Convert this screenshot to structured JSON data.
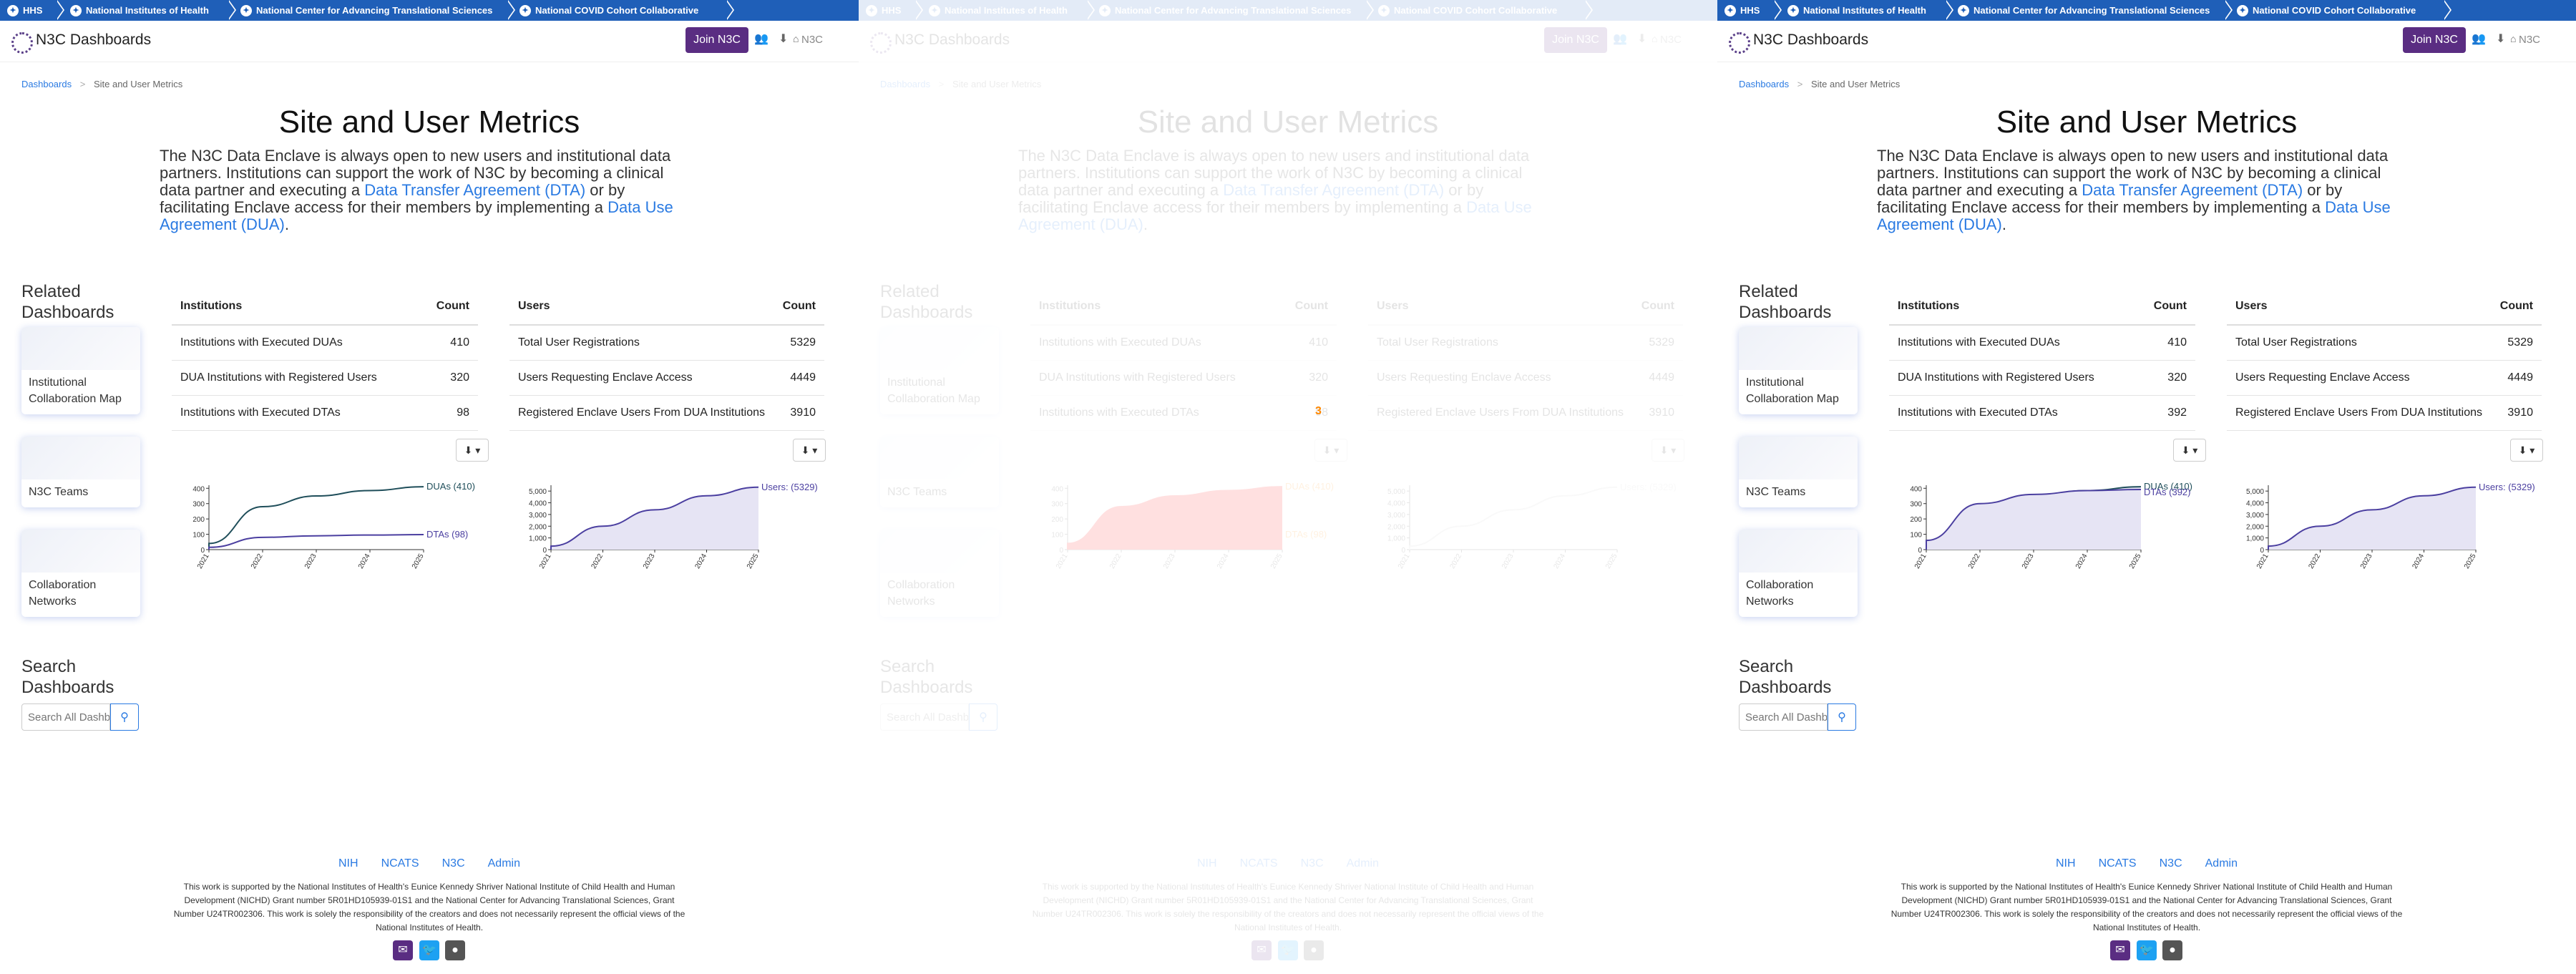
{
  "govbar": {
    "items": [
      "HHS",
      "National Institutes of Health",
      "National Center for Advancing Translational Sciences",
      "National COVID Cohort Collaborative"
    ]
  },
  "appbar": {
    "title": "N3C Dashboards",
    "join_label": "Join N3C",
    "n3c_label": "N3C"
  },
  "breadcrumb": {
    "root": "Dashboards",
    "current": "Site and User Metrics",
    "separator": ">"
  },
  "page": {
    "title": "Site and User Metrics",
    "intro_1": "The N3C Data Enclave is always open to new users and institutional data partners. Institutions can support the work of N3C by becoming a clinical data partner and executing a",
    "dta_link": "Data Transfer Agreement (DTA)",
    "intro_2": "or by facilitating Enclave access for their members by implementing a",
    "dua_link": "Data Use Agreement (DUA)",
    "intro_3": "."
  },
  "sidebar": {
    "related_heading": "Related Dashboards",
    "cards": [
      "Institutional Collaboration Map",
      "N3C Teams",
      "Collaboration Networks"
    ],
    "search_heading": "Search Dashboards",
    "search_placeholder": "Search All Dashboards"
  },
  "institutions": {
    "header": "Institutions",
    "count_header": "Count",
    "rows": [
      {
        "label": "Institutions with Executed DUAs",
        "value": "410"
      },
      {
        "label": "DUA Institutions with Registered Users",
        "value": "320"
      },
      {
        "label": "Institutions with Executed DTAs",
        "value": "98"
      }
    ]
  },
  "users": {
    "header": "Users",
    "count_header": "Count",
    "rows": [
      {
        "label": "Total User Registrations",
        "value": "5329"
      },
      {
        "label": "Users Requesting Enclave Access",
        "value": "4449"
      },
      {
        "label": "Registered Enclave Users From DUA Institutions",
        "value": "3910"
      }
    ]
  },
  "panel3_overrides": {
    "dta_count": "392"
  },
  "panel2": {
    "highlight_value": "3"
  },
  "footer": {
    "links": [
      "NIH",
      "NCATS",
      "N3C",
      "Admin"
    ],
    "note": "This work is supported by the National Institutes of Health's Eunice Kennedy Shriver National Institute of Child Health and Human Development (NICHD) Grant number 5R01HD105939-01S1 and the National Center for Advancing Translational Sciences, Grant Number U24TR002306. This work is solely the responsibility of the creators and does not necessarily represent the official views of the National Institutes of Health."
  },
  "colors": {
    "govbar": "#1f5fb8",
    "brand": "#5a2d82",
    "link": "#2a7ae2",
    "dua_line": "#1f4e5a",
    "dta_line": "#4b3fa0",
    "user_line": "#4b3fa0",
    "area_fill": "#e6e4f4",
    "error_fill": "#ff0000",
    "error_text": "#ff8800"
  },
  "chart_data": [
    {
      "type": "line",
      "x": [
        "2021",
        "2022",
        "2023",
        "2024",
        "2025"
      ],
      "series": [
        {
          "name": "DUAs (410)",
          "values": [
            40,
            280,
            350,
            385,
            410
          ]
        },
        {
          "name": "DTAs (98)",
          "values": [
            15,
            80,
            90,
            95,
            98
          ]
        }
      ],
      "yticks": [
        0,
        100,
        200,
        300,
        400
      ],
      "ylim": [
        0,
        420
      ]
    },
    {
      "type": "area",
      "x": [
        "2021",
        "2022",
        "2023",
        "2024",
        "2025"
      ],
      "series": [
        {
          "name": "Users: (5329)",
          "values": [
            300,
            2000,
            3400,
            4600,
            5329
          ]
        }
      ],
      "yticks": [
        "0",
        "1,000",
        "2,000",
        "3,000",
        "4,000",
        "5,000"
      ],
      "ylim": [
        0,
        5500
      ]
    },
    {
      "type": "area",
      "x": [
        "2021",
        "2022",
        "2023",
        "2024",
        "2025"
      ],
      "series": [
        {
          "name": "DUAs (410)",
          "values": [
            40,
            280,
            350,
            385,
            410
          ]
        },
        {
          "name": "DTAs (392)",
          "values": [
            60,
            300,
            360,
            385,
            392
          ]
        }
      ],
      "yticks": [
        0,
        100,
        200,
        300,
        400
      ],
      "ylim": [
        0,
        420
      ]
    }
  ]
}
